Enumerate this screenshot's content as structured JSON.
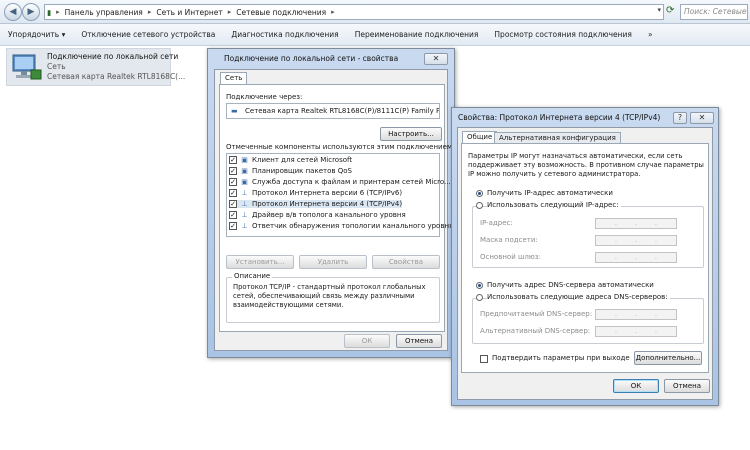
{
  "address": {
    "crumbs": [
      "Панель управления",
      "Сеть и Интернет",
      "Сетевые подключения"
    ],
    "search_placeholder": "Поиск: Сетевые ..."
  },
  "toolbar": [
    "Упорядочить ▾",
    "Отключение сетевого устройства",
    "Диагностика подключения",
    "Переименование подключения",
    "Просмотр состояния подключения",
    "»"
  ],
  "adapter": {
    "name": "Подключение по локальной сети",
    "status": "Сеть",
    "device": "Сетевая карта Realtek RTL8168C(..."
  },
  "props": {
    "title": "Подключение по локальной сети - свойства",
    "close": "✕",
    "tab": "Сеть",
    "connect_via_label": "Подключение через:",
    "adapter_name": "Сетевая карта Realtek RTL8168C(P)/8111C(P) Family P",
    "configure": "Настроить...",
    "components_label": "Отмеченные компоненты используются этим подключением:",
    "components": [
      "Клиент для сетей Microsoft",
      "Планировщик пакетов QoS",
      "Служба доступа к файлам и принтерам сетей Micro...",
      "Протокол Интернета версии 6 (TCP/IPv6)",
      "Протокол Интернета версии 4 (TCP/IPv4)",
      "Драйвер в/в тополога канального уровня",
      "Ответчик обнаружения топологии канального уровня"
    ],
    "install": "Установить...",
    "remove": "Удалить",
    "properties": "Свойства",
    "desc_title": "Описание",
    "desc_lines": [
      "Протокол TCP/IP - стандартный протокол глобальных",
      "сетей, обеспечивающий связь между различными",
      "взаимодействующими сетями."
    ],
    "ok": "ОК",
    "cancel": "Отмена"
  },
  "ipv4": {
    "title": "Свойства: Протокол Интернета версии 4 (TCP/IPv4)",
    "help": "?",
    "close": "✕",
    "tab_general": "Общие",
    "tab_alt": "Альтернативная конфигурация",
    "intro_lines": [
      "Параметры IP могут назначаться автоматически, если сеть",
      "поддерживает эту возможность. В противном случае параметры",
      "IP можно получить у сетевого администратора."
    ],
    "auto_ip": "Получить IP-адрес автоматически",
    "manual_ip": "Использовать следующий IP-адрес:",
    "ip_label": "IP-адрес:",
    "mask_label": "Маска подсети:",
    "gateway_label": "Основной шлюз:",
    "auto_dns": "Получить адрес DNS-сервера автоматически",
    "manual_dns": "Использовать следующие адреса DNS-серверов:",
    "pref_dns": "Предпочитаемый DNS-сервер:",
    "alt_dns": "Альтернативный DNS-сервер:",
    "validate": "Подтвердить параметры при выходе",
    "advanced": "Дополнительно...",
    "ok": "ОК",
    "cancel": "Отмена"
  }
}
